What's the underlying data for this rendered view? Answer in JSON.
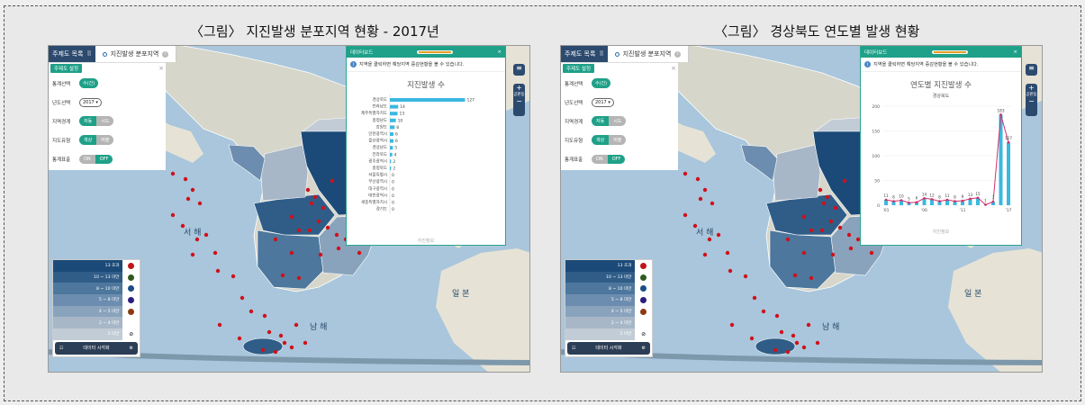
{
  "captions": [
    "〈그림〉 지진발생 분포지역 현황 - 2017년",
    "〈그림〉 경상북도 연도별 발생 현황"
  ],
  "topbar": {
    "menu_label": "주제도 목록",
    "tab_label": "지진발생 분포지역",
    "info": "i"
  },
  "settings": {
    "title": "주제도 설정",
    "close": "×",
    "rows": [
      {
        "label": "통계선택",
        "type": "pill",
        "value": "수(건)"
      },
      {
        "label": "년도선택",
        "type": "select",
        "value": "2017 ▾"
      },
      {
        "label": "지역경계",
        "type": "toggle",
        "on": "자동",
        "off": "시도"
      },
      {
        "label": "지도유형",
        "type": "toggle",
        "on": "색상",
        "off": "버블"
      },
      {
        "label": "통계표출",
        "type": "toggle2",
        "on": "ON",
        "off": "OFF"
      }
    ]
  },
  "dashboard": {
    "title": "데이터보드",
    "note": "지역을 클릭하면 해당지역 증감현황을 볼 수 있습니다.",
    "source": "지진정보"
  },
  "chart_data": [
    {
      "type": "bar",
      "orientation": "horizontal",
      "title": "지진발생 수",
      "categories": [
        "경상북도",
        "전라남도",
        "제주특별자치도",
        "충청남도",
        "강원도",
        "인천광역시",
        "울산광역시",
        "경상남도",
        "전라북도",
        "광주광역시",
        "충청북도",
        "서울특별시",
        "부산광역시",
        "대구광역시",
        "대전광역시",
        "세종특별자치시",
        "경기도"
      ],
      "values": [
        127,
        14,
        13,
        10,
        8,
        6,
        6,
        5,
        4,
        2,
        2,
        0,
        0,
        0,
        0,
        0,
        0
      ],
      "xlim": [
        0,
        140
      ]
    },
    {
      "type": "line",
      "title": "연도별 지진발생 수",
      "subtitle": "경상북도",
      "x": [
        "'01",
        "'02",
        "'03",
        "'04",
        "'05",
        "'06",
        "'07",
        "'08",
        "'09",
        "'10",
        "'11",
        "'12",
        "'13",
        "'14",
        "'15",
        "'16",
        "'17"
      ],
      "x_ticks": [
        "'01",
        "'06",
        "'11",
        "'17"
      ],
      "values": [
        11,
        8,
        10,
        5,
        6,
        14,
        12,
        8,
        11,
        8,
        9,
        13,
        15,
        1,
        7,
        183,
        127
      ],
      "ylim": [
        0,
        200
      ],
      "yticks": [
        0,
        50,
        100,
        150,
        200
      ],
      "colors": {
        "bar": "#3bb8e0",
        "line": "#d3306a"
      }
    }
  ],
  "legend": {
    "rows": [
      {
        "label": "13 초과",
        "color": "#1b4a78",
        "dot": "#c0161b"
      },
      {
        "label": "10 ~ 13 미만",
        "color": "#305d88",
        "dot": "#2f5a1f"
      },
      {
        "label": "8 ~ 10 미만",
        "color": "#4d779d",
        "dot": "#1a4c86"
      },
      {
        "label": "5 ~ 8 미만",
        "color": "#6c8daf",
        "dot": "#2b1d7e"
      },
      {
        "label": "4 ~ 5 미만",
        "color": "#8aa3bd",
        "dot": "#8a3a12"
      },
      {
        "label": "2 ~ 4 미만",
        "color": "#a7b7c8",
        "dot": ""
      },
      {
        "label": "2 미만",
        "color": "#c2ccd6",
        "dot": ""
      }
    ],
    "footer": "데이터 시각화"
  },
  "map": {
    "labels": {
      "west_sea": "서 해",
      "south_sea": "남 해",
      "japan": "일 본"
    },
    "ctrl_label": "공판동",
    "colors": {
      "sea": "#a9c6dc",
      "land_other": "#e6e3d6",
      "quake_dot": "#d0101a"
    }
  }
}
